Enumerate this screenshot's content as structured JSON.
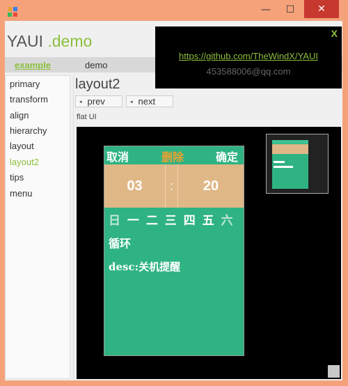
{
  "window": {
    "minimize_glyph": "—",
    "maximize_glyph": "☐",
    "close_glyph": "✕"
  },
  "brand": {
    "name": "YAUI",
    "suffix": ".demo"
  },
  "nav": {
    "example": "example",
    "demo": "demo"
  },
  "sidebar": {
    "items": [
      {
        "label": "primary"
      },
      {
        "label": "transform"
      },
      {
        "label": "align"
      },
      {
        "label": "hierarchy"
      },
      {
        "label": "layout"
      },
      {
        "label": "layout2",
        "active": true
      },
      {
        "label": "tips"
      },
      {
        "label": "menu"
      }
    ]
  },
  "main": {
    "title": "layout2",
    "prev_label": "prev",
    "next_label": "next",
    "arrow_glyph": "◂",
    "flat_label": "flat UI"
  },
  "alarm": {
    "cancel": "取消",
    "delete": "删除",
    "confirm": "确定",
    "hour": "03",
    "colon": ":",
    "minute": "20",
    "weekdays": [
      "日",
      "一",
      "二",
      "三",
      "四",
      "五",
      "六"
    ],
    "repeat": "循环",
    "desc": "desc:关机提醒"
  },
  "popup": {
    "close": "X",
    "link": "https://github.com/TheWindX/YAUI",
    "email": "453588006@qq.com"
  },
  "colors": {
    "accent": "#8cbf3c",
    "close_red": "#c7382f",
    "alarm_green": "#2fb383",
    "alarm_tan": "#e0b787",
    "delete_orange": "#f0a030"
  }
}
